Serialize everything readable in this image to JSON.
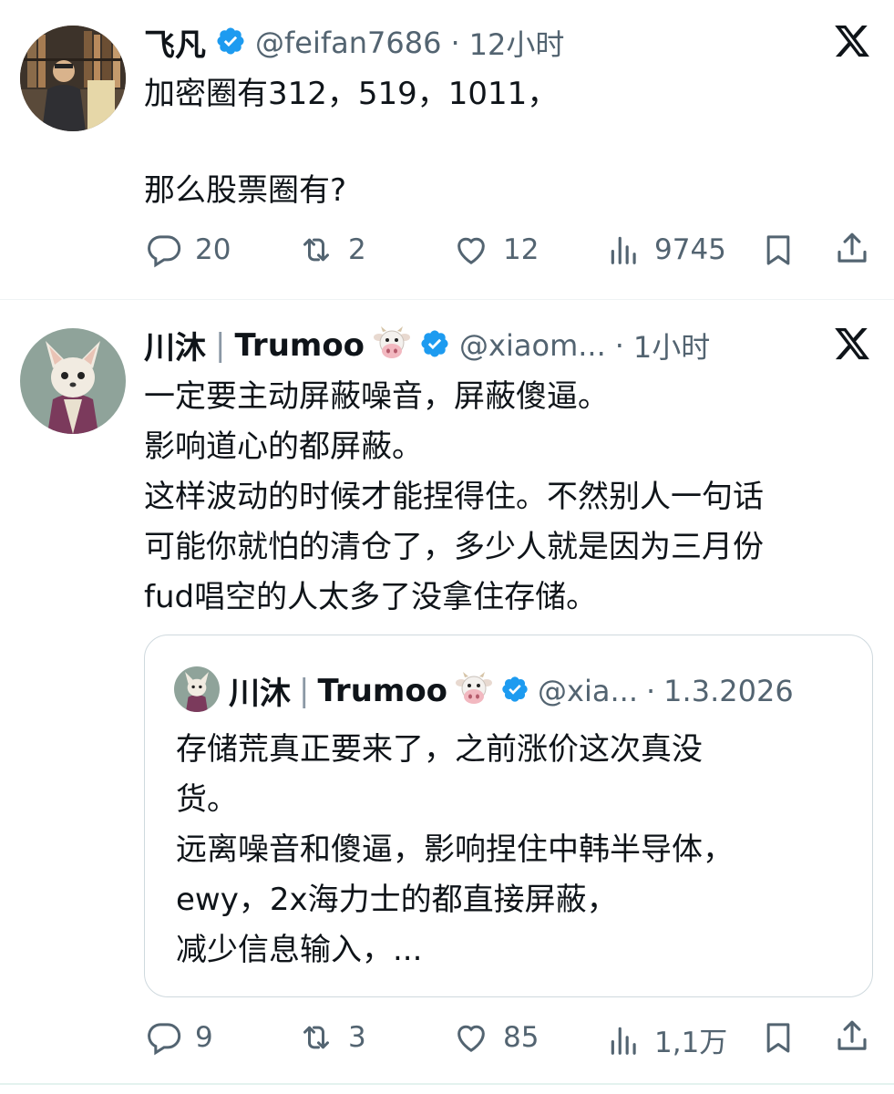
{
  "tweet1": {
    "author_name": "飞凡",
    "handle": "@feifan7686",
    "dot": "·",
    "time": "12小时",
    "text_line1": "加密圈有312，519，1011，",
    "text_line2": "那么股票圈有?",
    "replies": "20",
    "retweets": "2",
    "likes": "12",
    "views": "9745"
  },
  "tweet2": {
    "author_name": "川沐",
    "name_sep": "|",
    "author_name_latin": "Trumoo",
    "handle": "@xiaom...",
    "dot": "·",
    "time": "1小时",
    "lines": [
      "一定要主动屏蔽噪音，屏蔽傻逼。",
      "影响道心的都屏蔽。",
      "这样波动的时候才能捏得住。不然别人一句话",
      "可能你就怕的清仓了，多少人就是因为三月份",
      "fud唱空的人太多了没拿住存储。"
    ],
    "quote": {
      "author_name": "川沐",
      "name_sep": "|",
      "author_name_latin": "Trumoo",
      "handle": "@xia...",
      "dot": "·",
      "date": "1.3.2026",
      "lines": [
        "存储荒真正要来了，之前涨价这次真没",
        "货。",
        "远离噪音和傻逼，影响捏住中韩半导体，",
        "ewy，2x海力士的都直接屏蔽，",
        "减少信息输入，..."
      ]
    },
    "replies": "9",
    "retweets": "3",
    "likes": "85",
    "views": "1,1万"
  },
  "colors": {
    "verified_blue": "#1d9bf0",
    "text": "#0f1419",
    "secondary": "#536471",
    "border": "#cfd9de"
  },
  "icons": [
    "x-logo-icon",
    "verified-badge-icon",
    "cow-face-icon",
    "reply-icon",
    "retweet-icon",
    "like-icon",
    "views-icon",
    "bookmark-icon",
    "share-icon"
  ]
}
